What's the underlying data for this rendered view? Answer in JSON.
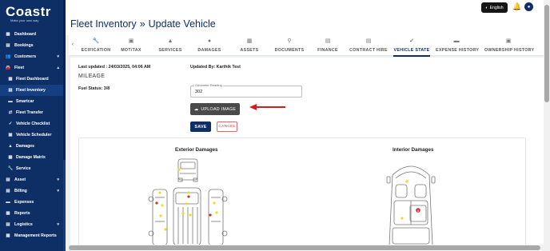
{
  "brand": {
    "logo": "Coastr",
    "tagline": "Make your own way"
  },
  "sidebar": {
    "items": [
      {
        "label": "Dashboard",
        "icon": "dashboard-icon",
        "glyph": "▦"
      },
      {
        "label": "Bookings",
        "icon": "bookings-icon",
        "glyph": "▤"
      },
      {
        "label": "Customers",
        "icon": "customers-icon",
        "glyph": "👥",
        "chevron": "▾"
      },
      {
        "label": "Fleet",
        "icon": "fleet-icon",
        "glyph": "🚘",
        "chevron": "▴"
      },
      {
        "label": "Fleet Dashboard",
        "icon": "fleet-dashboard-icon",
        "glyph": "▦",
        "sub": true
      },
      {
        "label": "Fleet Inventory",
        "icon": "fleet-inventory-icon",
        "glyph": "▤",
        "sub": true,
        "active": true
      },
      {
        "label": "Smartcar",
        "icon": "smartcar-icon",
        "glyph": "▬",
        "sub": true
      },
      {
        "label": "Fleet Transfer",
        "icon": "fleet-transfer-icon",
        "glyph": "⇄",
        "sub": true
      },
      {
        "label": "Vehicle Checklist",
        "icon": "checklist-icon",
        "glyph": "✓",
        "sub": true
      },
      {
        "label": "Vehicle Scheduler",
        "icon": "scheduler-icon",
        "glyph": "▣",
        "sub": true
      },
      {
        "label": "Damages",
        "icon": "damages-icon",
        "glyph": "▲",
        "sub": true
      },
      {
        "label": "Damage Matrix",
        "icon": "damage-matrix-icon",
        "glyph": "▦",
        "sub": true
      },
      {
        "label": "Service",
        "icon": "service-icon",
        "glyph": "🔧",
        "sub": true
      },
      {
        "label": "Asset",
        "icon": "asset-icon",
        "glyph": "▤",
        "chevron": "▾"
      },
      {
        "label": "Billing",
        "icon": "billing-icon",
        "glyph": "▤",
        "chevron": "▾"
      },
      {
        "label": "Expenses",
        "icon": "expenses-icon",
        "glyph": "▬"
      },
      {
        "label": "Reports",
        "icon": "reports-icon",
        "glyph": "▦"
      },
      {
        "label": "Logistics",
        "icon": "logistics-icon",
        "glyph": "▤",
        "chevron": "▾"
      },
      {
        "label": "Management Reports",
        "icon": "management-reports-icon",
        "glyph": "▦"
      }
    ]
  },
  "topbar": {
    "language": "English"
  },
  "header": {
    "title": "Fleet Inventory",
    "separator": "»",
    "subtitle": "Update Vehicle"
  },
  "tabs": [
    {
      "label": "ECIFICATION",
      "icon": "wrench-icon",
      "glyph": "🔧"
    },
    {
      "label": "MOT/TAX",
      "icon": "mot-tax-icon",
      "glyph": "▣"
    },
    {
      "label": "SERVICES",
      "icon": "services-icon",
      "glyph": "▲"
    },
    {
      "label": "DAMAGES",
      "icon": "damages-tab-icon",
      "glyph": "●"
    },
    {
      "label": "ASSETS",
      "icon": "assets-icon",
      "glyph": "▦"
    },
    {
      "label": "DOCUMENTS",
      "icon": "documents-icon",
      "glyph": "⚲"
    },
    {
      "label": "FINANCE",
      "icon": "finance-icon",
      "glyph": "▤"
    },
    {
      "label": "CONTRACT HIRE",
      "icon": "contract-hire-icon",
      "glyph": "▤"
    },
    {
      "label": "VEHICLE STATE",
      "icon": "vehicle-state-icon",
      "glyph": "✓",
      "active": true
    },
    {
      "label": "EXPENSE HISTORY",
      "icon": "expense-history-icon",
      "glyph": "▬"
    },
    {
      "label": "OWNERSHIP HISTORY",
      "icon": "ownership-history-icon",
      "glyph": "▣"
    }
  ],
  "vehicle_state": {
    "last_updated": "Last updated : 24/03/2025, 04:06 AM",
    "updated_by": "Updated By: Karthik Test",
    "mileage_heading": "MILEAGE",
    "fuel_status": "Fuel Status: 3/8",
    "odometer_label": "Odometer Reading",
    "odometer_value": "302",
    "upload_label": "UPLOAD IMAGE",
    "save_label": "SAVE",
    "cancel_label": "CANCEL"
  },
  "damages": {
    "exterior_title": "Exterior Damages",
    "interior_title": "Interior Damages",
    "interior_marker_label": "8"
  },
  "colors": {
    "primary": "#0d2f66",
    "arrow": "#d11f1f",
    "damage_dot": "#f2dd1d",
    "damage_red": "#d32f2f"
  }
}
